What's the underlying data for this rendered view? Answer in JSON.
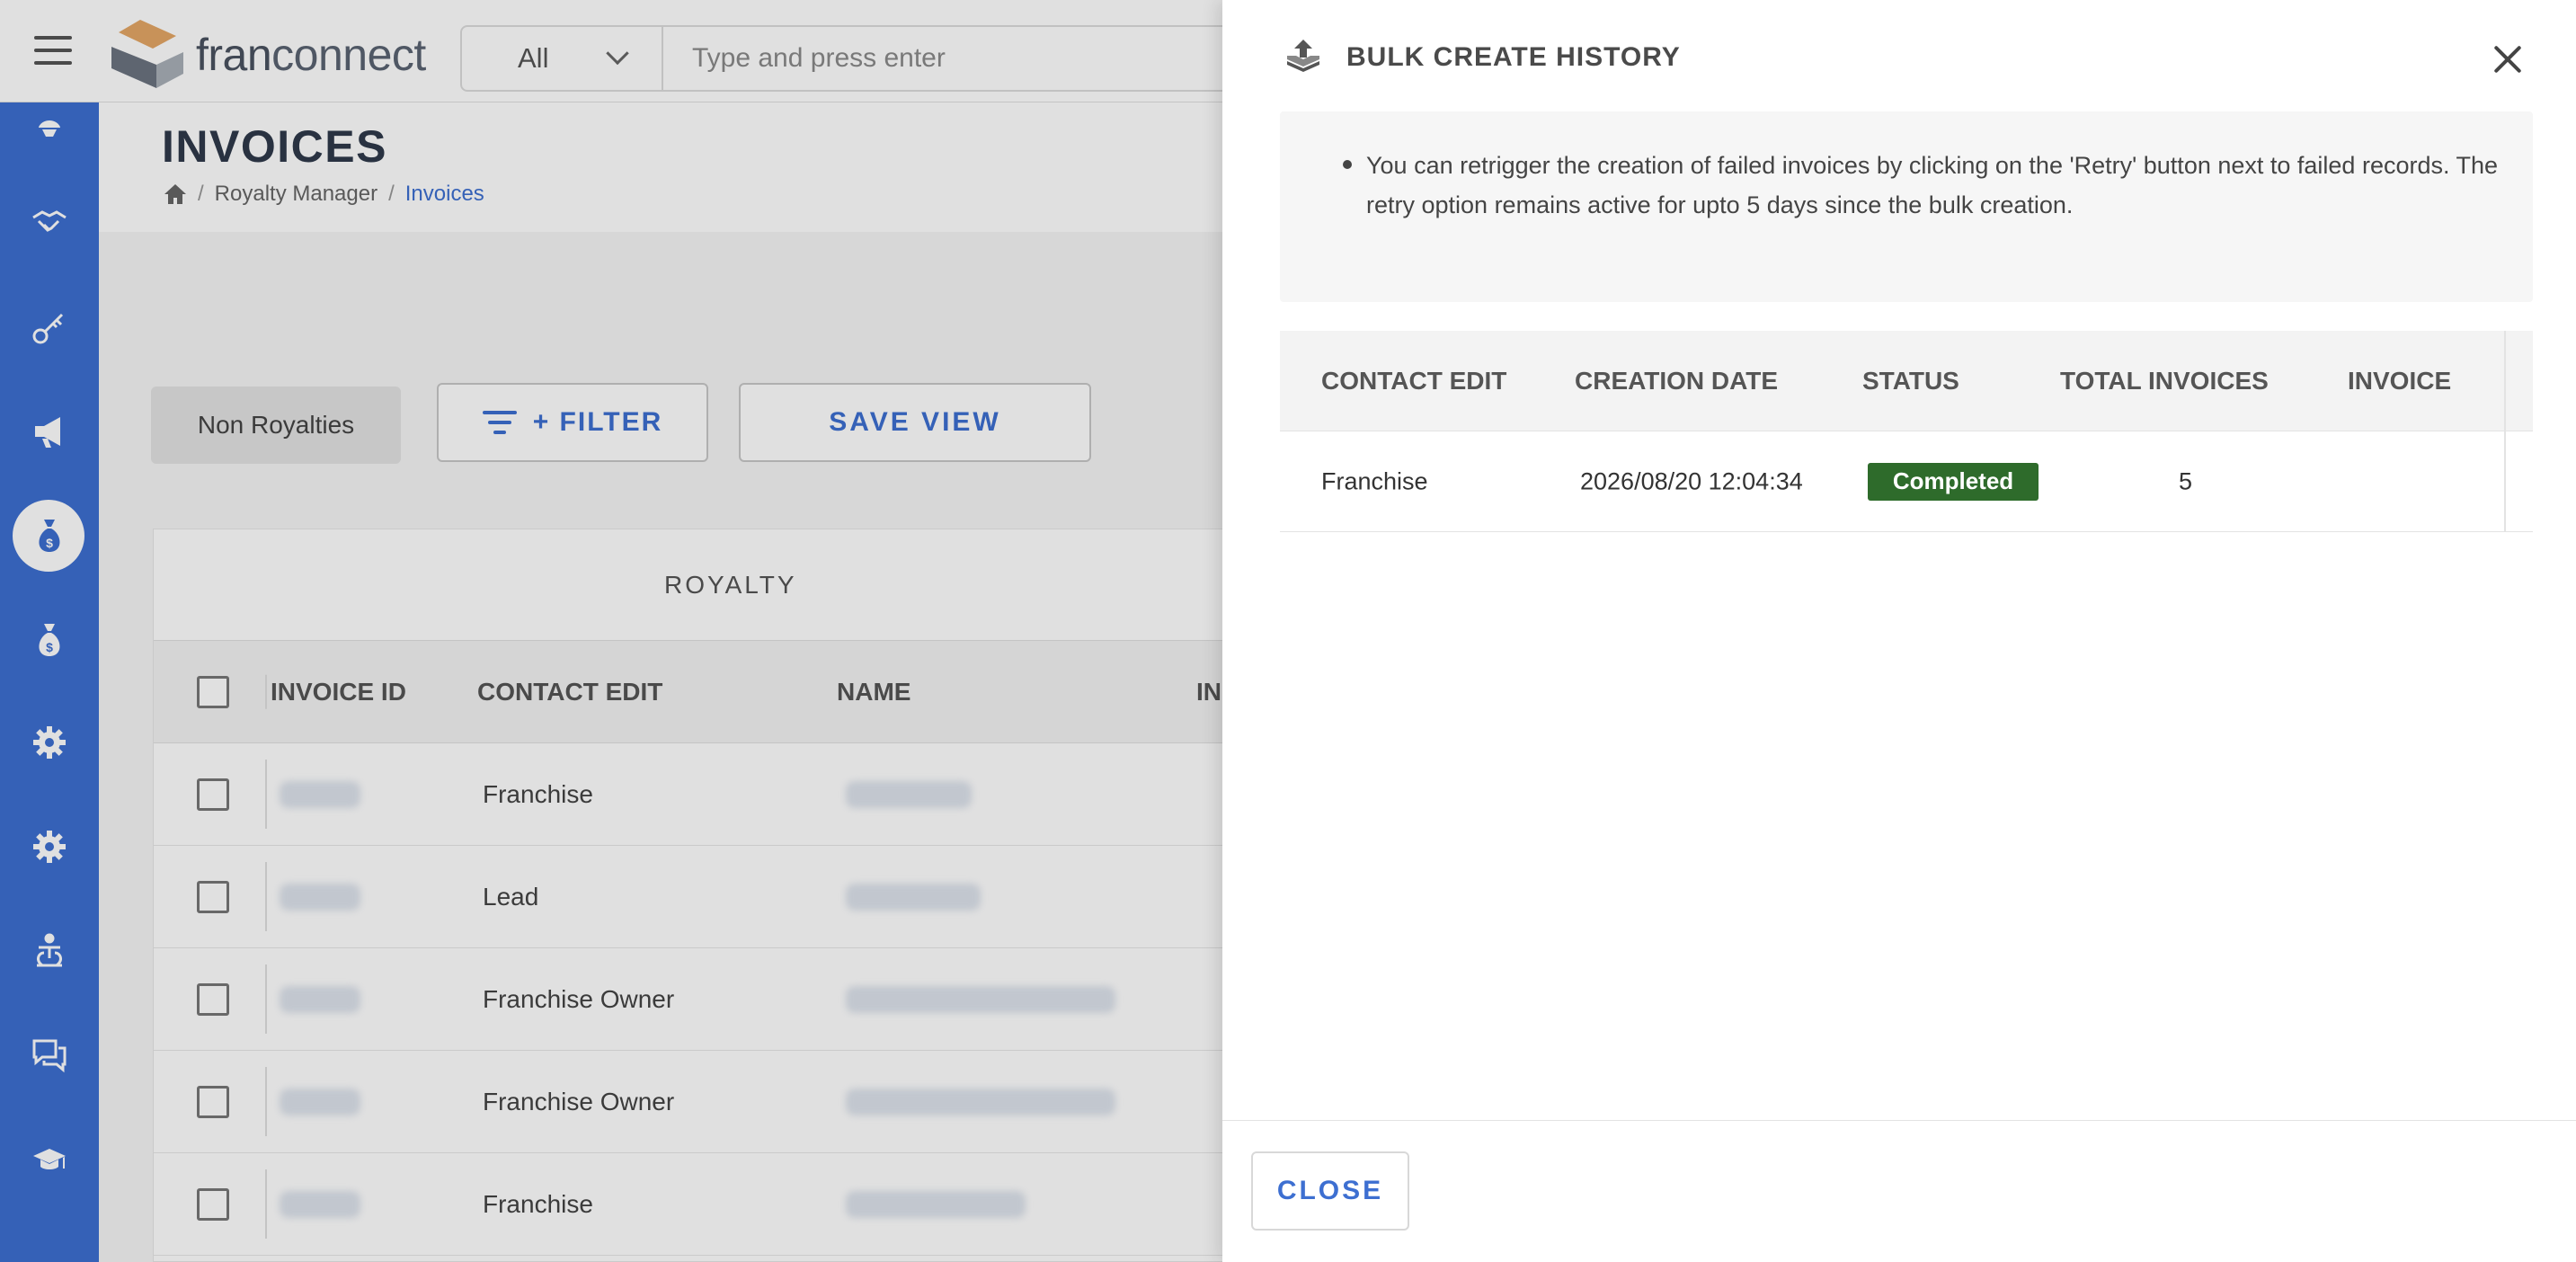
{
  "header": {
    "logo_text_a": "fran",
    "logo_text_b": "connect",
    "search_scope": "All",
    "search_placeholder": "Type and press enter"
  },
  "sidebar": {
    "icons": [
      "lightbulb-icon",
      "handshake-icon",
      "key-icon",
      "megaphone-icon",
      "money-bag-icon",
      "money-bag-icon",
      "gear-icon",
      "gear-icon",
      "accessibility-icon",
      "chat-icon",
      "graduation-cap-icon"
    ],
    "active_index": 4,
    "color": "#3d6fd1"
  },
  "page": {
    "title": "INVOICES",
    "breadcrumb": [
      "Royalty Manager",
      "Invoices"
    ]
  },
  "toolbar": {
    "non_royalties_label": "Non Royalties",
    "filter_label": "+ FILTER",
    "save_view_label": "SAVE VIEW"
  },
  "grid": {
    "group_label": "ROYALTY",
    "columns": [
      "INVOICE ID",
      "CONTACT EDIT",
      "NAME",
      "IN"
    ],
    "rows": [
      {
        "contact": "Franchise"
      },
      {
        "contact": "Lead"
      },
      {
        "contact": "Franchise Owner"
      },
      {
        "contact": "Franchise Owner"
      },
      {
        "contact": "Franchise"
      }
    ]
  },
  "drawer": {
    "title": "BULK CREATE HISTORY",
    "info": "You can retrigger the creation of failed invoices by clicking on the 'Retry' button next to failed records. The retry option remains active for upto 5 days since the bulk creation.",
    "columns": [
      "CONTACT EDIT",
      "CREATION DATE",
      "STATUS",
      "TOTAL INVOICES",
      "INVOICE"
    ],
    "rows": [
      {
        "contact": "Franchise",
        "created": "2026/08/20 12:04:34",
        "status": "Completed",
        "total": "5"
      }
    ],
    "status_color": "#2e6b2b",
    "close_label": "CLOSE"
  }
}
